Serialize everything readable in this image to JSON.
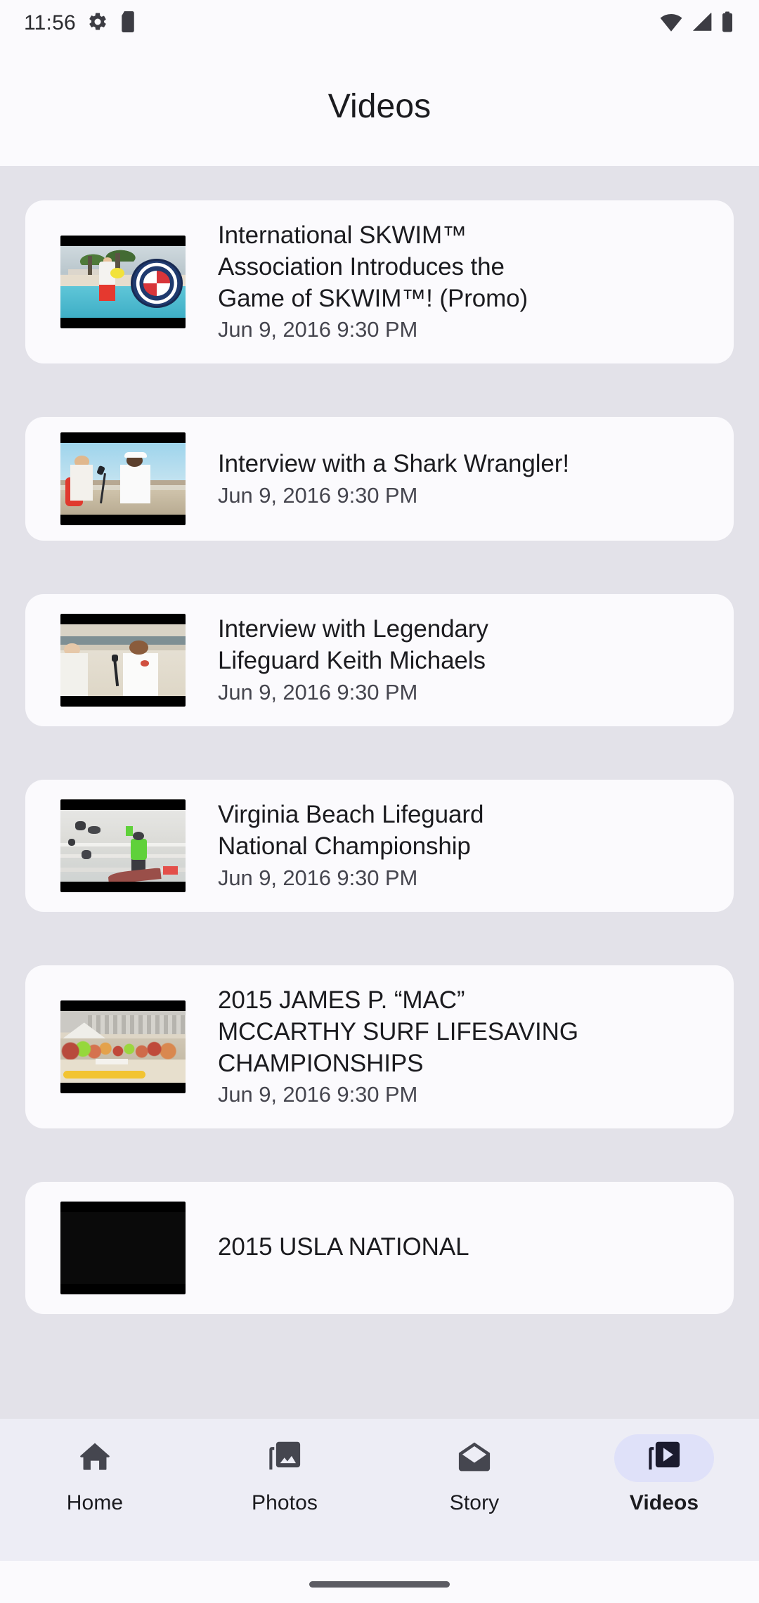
{
  "status_bar": {
    "time": "11:56",
    "left_icons": [
      "gear-icon",
      "sd-card-icon"
    ],
    "right_icons": [
      "wifi-icon",
      "cellular-signal-icon",
      "battery-icon"
    ]
  },
  "app_bar": {
    "title": "Videos"
  },
  "videos": [
    {
      "title": "International SKWIM™\nAssociation Introduces the\nGame of SKWIM™! (Promo)",
      "date": "Jun 9, 2016 9:30 PM",
      "thumbnail": "skwim-promo-pool-thumbnail"
    },
    {
      "title": "Interview with a Shark Wrangler!",
      "date": "Jun 9, 2016 9:30 PM",
      "thumbnail": "shark-wrangler-interview-thumbnail"
    },
    {
      "title": "Interview with Legendary\nLifeguard Keith Michaels",
      "date": "Jun 9, 2016 9:30 PM",
      "thumbnail": "keith-michaels-interview-thumbnail"
    },
    {
      "title": "Virginia Beach Lifeguard\nNational Championship",
      "date": "Jun 9, 2016 9:30 PM",
      "thumbnail": "virginia-beach-championship-thumbnail"
    },
    {
      "title": "2015 JAMES P. “MAC”\nMCCARTHY SURF LIFESAVING\nCHAMPIONSHIPS",
      "date": "Jun 9, 2016 9:30 PM",
      "thumbnail": "mac-mccarthy-championships-thumbnail"
    },
    {
      "title": "2015 USLA NATIONAL",
      "date": "",
      "thumbnail": "usla-national-thumbnail"
    }
  ],
  "bottom_nav": {
    "items": [
      {
        "label": "Home",
        "icon": "home-icon",
        "selected": false
      },
      {
        "label": "Photos",
        "icon": "photo-library-icon",
        "selected": false
      },
      {
        "label": "Story",
        "icon": "mail-open-icon",
        "selected": false
      },
      {
        "label": "Videos",
        "icon": "video-library-icon",
        "selected": true
      }
    ],
    "selected_pill_color": "#DFE1F9",
    "icon_color": "#45464F",
    "selected_icon_color": "#1B1B2E"
  },
  "colors": {
    "screen_background": "#FBFAFD",
    "list_background": "#E3E2E9",
    "card_background": "#FBFAFD",
    "nav_background": "#EDEDF5",
    "title_text": "#1B1B1F",
    "secondary_text": "#46464F"
  }
}
